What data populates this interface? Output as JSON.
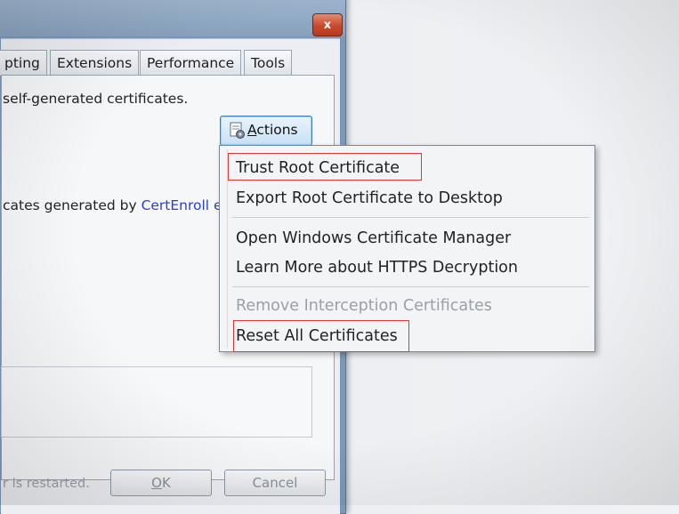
{
  "dialog": {
    "close_glyph": "x",
    "tabs": [
      "pting",
      "Extensions",
      "Performance",
      "Tools"
    ],
    "description_top": "self-generated certificates.",
    "description_mid_prefix": "cates generated by ",
    "description_mid_link": "CertEnroll e",
    "actions_label_first": "A",
    "actions_label_rest": "ctions",
    "restart_text": "r is restarted.",
    "ok_label_first": "O",
    "ok_label_rest": "K",
    "cancel_label": "Cancel"
  },
  "menu": {
    "items": [
      {
        "label": "Trust Root Certificate",
        "enabled": true,
        "highlighted": true
      },
      {
        "label": "Export Root Certificate to Desktop",
        "enabled": true,
        "highlighted": false
      },
      {
        "label": "Open Windows Certificate Manager",
        "enabled": true,
        "highlighted": false
      },
      {
        "label": "Learn More about HTTPS Decryption",
        "enabled": true,
        "highlighted": false
      },
      {
        "label": "Remove Interception Certificates",
        "enabled": false,
        "highlighted": false
      },
      {
        "label": "Reset All Certificates",
        "enabled": true,
        "highlighted": true
      }
    ]
  },
  "colors": {
    "highlight_box": "#d83a3a",
    "link": "#2b3ed0",
    "disabled_text": "#9aa0a8"
  }
}
